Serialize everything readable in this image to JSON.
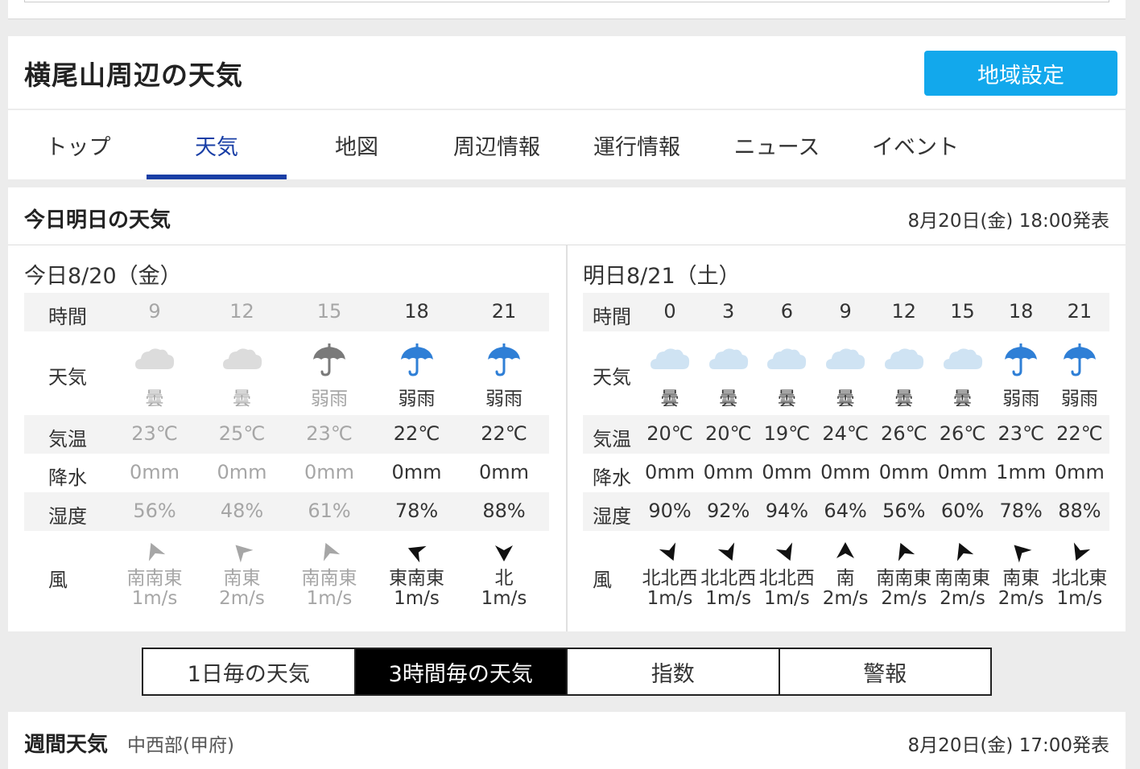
{
  "header": {
    "title": "横尾山周辺の天気",
    "region_button": "地域設定"
  },
  "tabs": [
    {
      "label": "トップ",
      "active": false
    },
    {
      "label": "天気",
      "active": true
    },
    {
      "label": "地図",
      "active": false
    },
    {
      "label": "周辺情報",
      "active": false
    },
    {
      "label": "運行情報",
      "active": false
    },
    {
      "label": "ニュース",
      "active": false
    },
    {
      "label": "イベント",
      "active": false
    }
  ],
  "forecast": {
    "title": "今日明日の天気",
    "timestamp": "8月20日(金) 18:00発表",
    "labels": {
      "time": "時間",
      "weather": "天気",
      "temp": "気温",
      "precip": "降水",
      "humidity": "湿度",
      "wind": "風"
    },
    "today": {
      "title": "今日8/20（金）",
      "slots": [
        {
          "time": "9",
          "weather": "曇",
          "icon": "cloud-icon",
          "temp": "23℃",
          "precip": "0mm",
          "humidity": "56%",
          "wind_dir": "南南東",
          "wind_speed": "1m/s",
          "past": true
        },
        {
          "time": "12",
          "weather": "曇",
          "icon": "cloud-icon",
          "temp": "25℃",
          "precip": "0mm",
          "humidity": "48%",
          "wind_dir": "南東",
          "wind_speed": "2m/s",
          "past": true
        },
        {
          "time": "15",
          "weather": "弱雨",
          "icon": "umbrella-icon",
          "temp": "23℃",
          "precip": "0mm",
          "humidity": "61%",
          "wind_dir": "南南東",
          "wind_speed": "1m/s",
          "past": true
        },
        {
          "time": "18",
          "weather": "弱雨",
          "icon": "umbrella-icon",
          "temp": "22℃",
          "precip": "0mm",
          "humidity": "78%",
          "wind_dir": "東南東",
          "wind_speed": "1m/s",
          "past": false
        },
        {
          "time": "21",
          "weather": "弱雨",
          "icon": "umbrella-icon",
          "temp": "22℃",
          "precip": "0mm",
          "humidity": "88%",
          "wind_dir": "北",
          "wind_speed": "1m/s",
          "past": false
        }
      ]
    },
    "tomorrow": {
      "title": "明日8/21（土）",
      "slots": [
        {
          "time": "0",
          "weather": "曇",
          "icon": "cloud-icon",
          "temp": "20℃",
          "precip": "0mm",
          "humidity": "90%",
          "wind_dir": "北北西",
          "wind_speed": "1m/s"
        },
        {
          "time": "3",
          "weather": "曇",
          "icon": "cloud-icon",
          "temp": "20℃",
          "precip": "0mm",
          "humidity": "92%",
          "wind_dir": "北北西",
          "wind_speed": "1m/s"
        },
        {
          "time": "6",
          "weather": "曇",
          "icon": "cloud-icon",
          "temp": "19℃",
          "precip": "0mm",
          "humidity": "94%",
          "wind_dir": "北北西",
          "wind_speed": "1m/s"
        },
        {
          "time": "9",
          "weather": "曇",
          "icon": "cloud-icon",
          "temp": "24℃",
          "precip": "0mm",
          "humidity": "64%",
          "wind_dir": "南",
          "wind_speed": "2m/s"
        },
        {
          "time": "12",
          "weather": "曇",
          "icon": "cloud-icon",
          "temp": "26℃",
          "precip": "0mm",
          "humidity": "56%",
          "wind_dir": "南南東",
          "wind_speed": "2m/s"
        },
        {
          "time": "15",
          "weather": "曇",
          "icon": "cloud-icon",
          "temp": "26℃",
          "precip": "0mm",
          "humidity": "60%",
          "wind_dir": "南南東",
          "wind_speed": "2m/s"
        },
        {
          "time": "18",
          "weather": "弱雨",
          "icon": "umbrella-icon",
          "temp": "23℃",
          "precip": "1mm",
          "humidity": "78%",
          "wind_dir": "南東",
          "wind_speed": "2m/s"
        },
        {
          "time": "21",
          "weather": "弱雨",
          "icon": "umbrella-icon",
          "temp": "22℃",
          "precip": "0mm",
          "humidity": "88%",
          "wind_dir": "北北東",
          "wind_speed": "1m/s"
        }
      ]
    }
  },
  "switcher": [
    {
      "label": "1日毎の天気",
      "active": false
    },
    {
      "label": "3時間毎の天気",
      "active": true
    },
    {
      "label": "指数",
      "active": false
    },
    {
      "label": "警報",
      "active": false
    }
  ],
  "weekly": {
    "title": "週間天気",
    "region": "中西部(甲府)",
    "timestamp": "8月20日(金) 17:00発表"
  },
  "colors": {
    "accent": "#12a8ec",
    "tab_active": "#1a3fa6",
    "rain_icon": "#2f7fd6",
    "cloud_icon": "#dcdcdc",
    "cloud_icon_tomorrow": "#cfe3f3",
    "past_text": "#a6a6a6"
  }
}
